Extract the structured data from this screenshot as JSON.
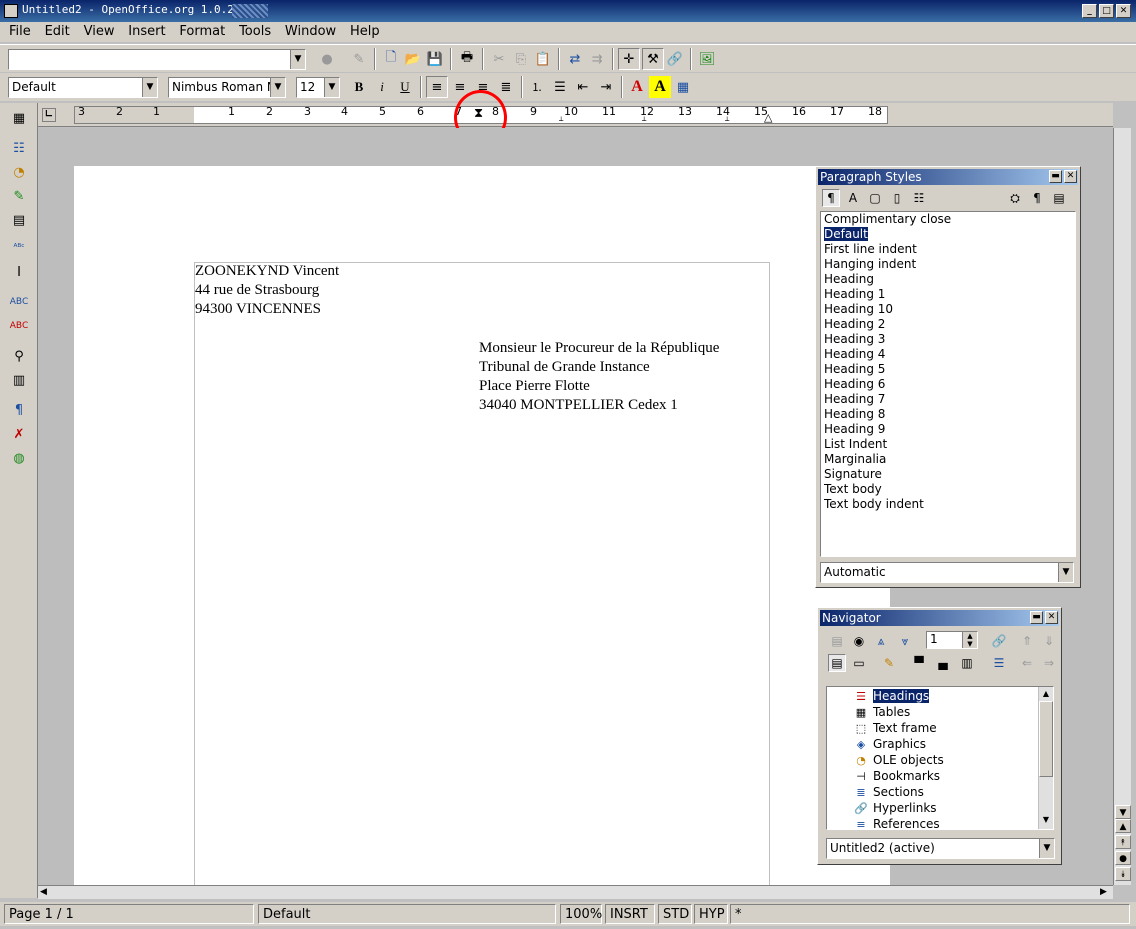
{
  "window": {
    "title": "Untitled2 - OpenOffice.org 1.0.2",
    "buttons": {
      "minimize": "_",
      "maximize": "□",
      "close": "✕"
    }
  },
  "menubar": [
    "File",
    "Edit",
    "View",
    "Insert",
    "Format",
    "Tools",
    "Window",
    "Help"
  ],
  "toolbar_format": {
    "paragraph_style": "Default",
    "font_name": "Nimbus Roman N",
    "font_size": "12"
  },
  "ruler": {
    "labels": [
      "3",
      "2",
      "1",
      "1",
      "2",
      "3",
      "4",
      "5",
      "6",
      "7",
      "8",
      "9",
      "10",
      "11",
      "12",
      "13",
      "14",
      "15",
      "16",
      "17",
      "18"
    ]
  },
  "document": {
    "sender": [
      "ZOONEKYND Vincent",
      "44 rue de Strasbourg",
      "94300 VINCENNES"
    ],
    "recipient": [
      "Monsieur le Procureur de la République",
      "Tribunal de Grande Instance",
      "Place Pierre Flotte",
      "34040 MONTPELLIER Cedex 1"
    ]
  },
  "paragraph_styles": {
    "title": "Paragraph Styles",
    "items": [
      "Complimentary close",
      "Default",
      "First line indent",
      "Hanging indent",
      "Heading",
      "Heading 1",
      "Heading 10",
      "Heading 2",
      "Heading 3",
      "Heading 4",
      "Heading 5",
      "Heading 6",
      "Heading 7",
      "Heading 8",
      "Heading 9",
      "List Indent",
      "Marginalia",
      "Signature",
      "Text body",
      "Text body indent"
    ],
    "selected": "Default",
    "filter": "Automatic"
  },
  "navigator": {
    "title": "Navigator",
    "page_number": "1",
    "items": [
      "Headings",
      "Tables",
      "Text frame",
      "Graphics",
      "OLE objects",
      "Bookmarks",
      "Sections",
      "Hyperlinks",
      "References"
    ],
    "selected": "Headings",
    "document": "Untitled2 (active)"
  },
  "statusbar": {
    "page": "Page 1 / 1",
    "style": "Default",
    "zoom": "100%",
    "insert_mode": "INSRT",
    "selection_mode": "STD",
    "hyperlink_mode": "HYP",
    "modified": "*"
  },
  "colors": {
    "titlebar": "#0a246a",
    "selection": "#0a246a",
    "annotation": "#ff0000"
  }
}
